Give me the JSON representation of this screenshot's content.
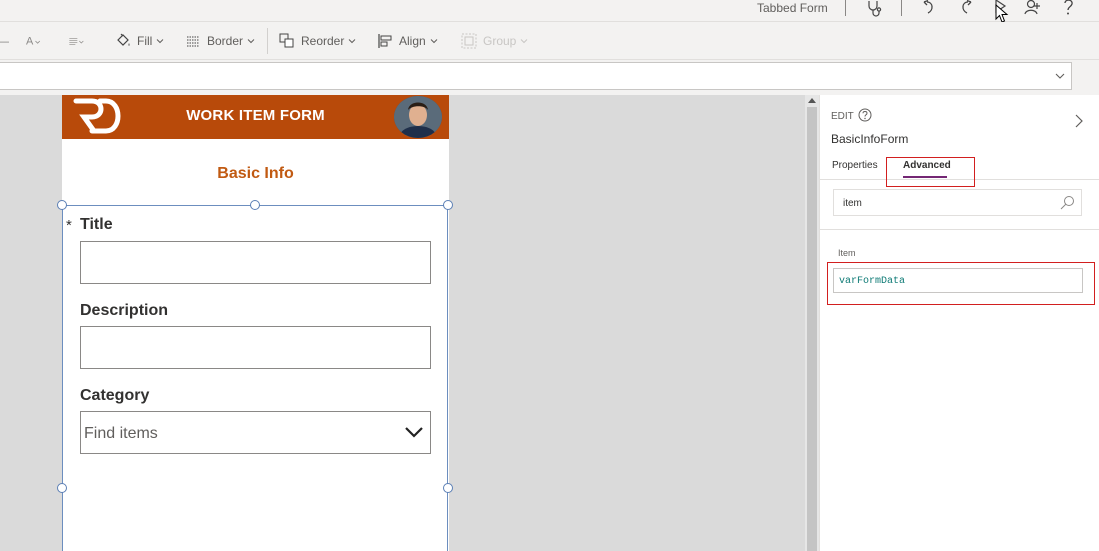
{
  "app": {
    "title": "Tabbed Form",
    "icons": [
      "stethoscope-icon",
      "undo-icon",
      "redo-icon",
      "play-icon",
      "share-icon",
      "help-icon"
    ]
  },
  "ribbon": {
    "fill_label": "Fill",
    "border_label": "Border",
    "reorder_label": "Reorder",
    "align_label": "Align",
    "group_label": "Group"
  },
  "screen": {
    "header_title": "WORK ITEM FORM",
    "section_title": "Basic Info",
    "fields": {
      "required_marker": "*",
      "title_label": "Title",
      "description_label": "Description",
      "category_label": "Category",
      "category_placeholder": "Find items"
    },
    "colors": {
      "header": "#b84a0a",
      "section": "#c15a12"
    }
  },
  "panel": {
    "edit_label": "EDIT",
    "control_name": "BasicInfoForm",
    "tabs": [
      {
        "label": "Properties",
        "active": false
      },
      {
        "label": "Advanced",
        "active": true
      }
    ],
    "search_value": "item",
    "property_label": "Item",
    "property_value": "varFormData",
    "colors": {
      "active_tab": "#742774",
      "highlight": "#d21f1f",
      "formula_text": "#0d7a75"
    }
  }
}
